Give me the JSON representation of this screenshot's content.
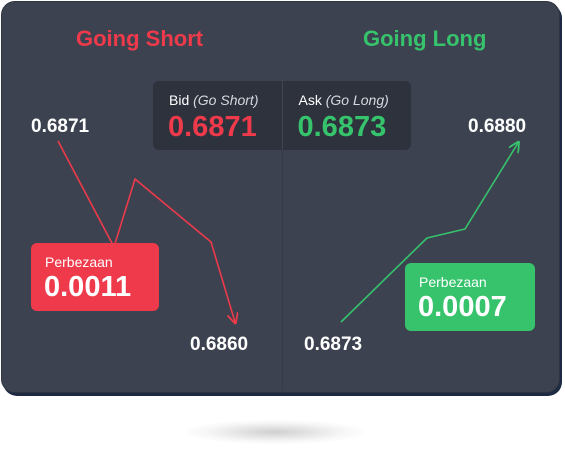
{
  "short": {
    "heading": "Going Short",
    "start_price": "0.6871",
    "end_price": "0.6860",
    "difference_label": "Perbezaan",
    "difference_value": "0.0011",
    "color": "#ee3a4a"
  },
  "long": {
    "heading": "Going Long",
    "start_price": "0.6873",
    "end_price": "0.6880",
    "difference_label": "Perbezaan",
    "difference_value": "0.0007",
    "color": "#36c36c"
  },
  "quote": {
    "bid_label": "Bid",
    "bid_note": "(Go Short)",
    "bid_value": "0.6871",
    "ask_label": "Ask",
    "ask_note": "(Go Long)",
    "ask_value": "0.6873"
  },
  "colors": {
    "card_background": "#3c4250",
    "quote_background": "#2d323d"
  }
}
